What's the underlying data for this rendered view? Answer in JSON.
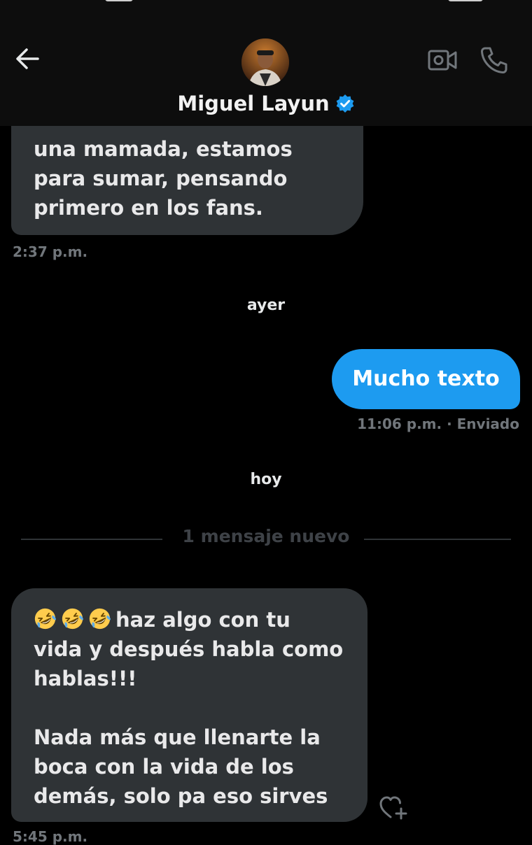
{
  "header": {
    "contact_name": "Miguel Layun",
    "verified": true
  },
  "messages": {
    "first": {
      "text": "una mamada, estamos\npara sumar, pensando\nprimero en los fans.",
      "time": "2:37 p.m."
    },
    "day_yesterday": "ayer",
    "sent": {
      "text": "Mucho texto",
      "meta": "11:06 p.m.  · Enviado"
    },
    "day_today": "hoy",
    "new_divider": "1 mensaje nuevo",
    "second": {
      "emoji": "rolling-on-floor-laughing",
      "emoji_count": 3,
      "text": "haz algo con tu\nvida y después habla como\nhablas!!!\n\nNada más que llenarte la\nboca con la vida de los\ndemás, solo pa eso sirves",
      "time": "5:45 p.m."
    }
  },
  "colors": {
    "background": "#000000",
    "header": "#0d0d0d",
    "incoming_bubble": "#2f3336",
    "outgoing_bubble": "#1d9bf0",
    "muted_text": "#71767b",
    "verified_badge": "#1d9bf0"
  }
}
